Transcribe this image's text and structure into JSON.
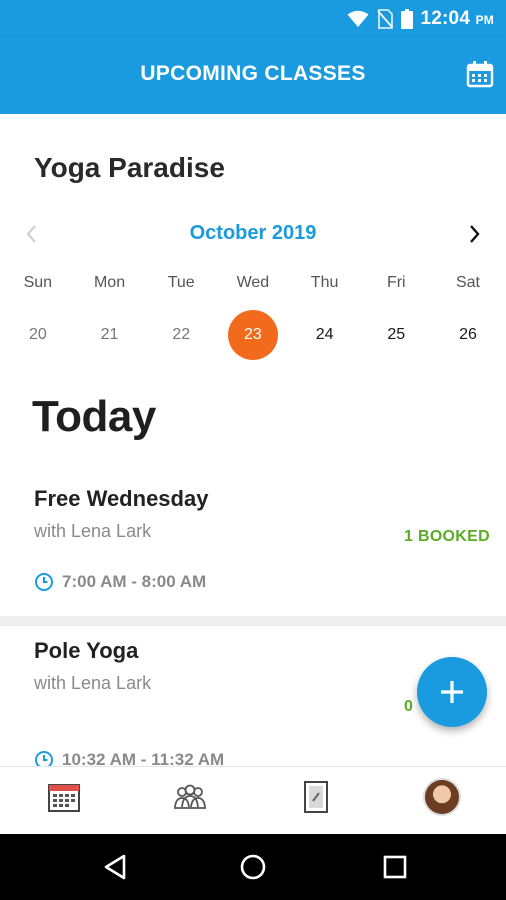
{
  "status_bar": {
    "time": "12:04",
    "ampm": "PM"
  },
  "app_bar": {
    "title": "UPCOMING CLASSES",
    "calendar_icon": "calendar-icon"
  },
  "studio": {
    "name": "Yoga Paradise"
  },
  "calendar": {
    "month": "October 2019",
    "weekdays": [
      "Sun",
      "Mon",
      "Tue",
      "Wed",
      "Thu",
      "Fri",
      "Sat"
    ],
    "days": [
      "20",
      "21",
      "22",
      "23",
      "24",
      "25",
      "26"
    ],
    "selected_day": "23"
  },
  "section": {
    "title": "Today"
  },
  "classes": [
    {
      "name": "Free Wednesday",
      "teacher": "with Lena Lark",
      "time": "7:00 AM - 8:00 AM",
      "status": "1 BOOKED"
    },
    {
      "name": "Pole Yoga",
      "teacher": "with Lena Lark",
      "time": "10:32 AM - 11:32 AM",
      "status": "0"
    }
  ],
  "colors": {
    "primary": "#1a9be0",
    "selected_day": "#f26b1d",
    "booked": "#5aab25"
  },
  "bottom_nav": {
    "items": [
      "calendar-icon",
      "group-icon",
      "pass-icon",
      "avatar"
    ]
  },
  "fab": {
    "icon": "plus-icon"
  }
}
